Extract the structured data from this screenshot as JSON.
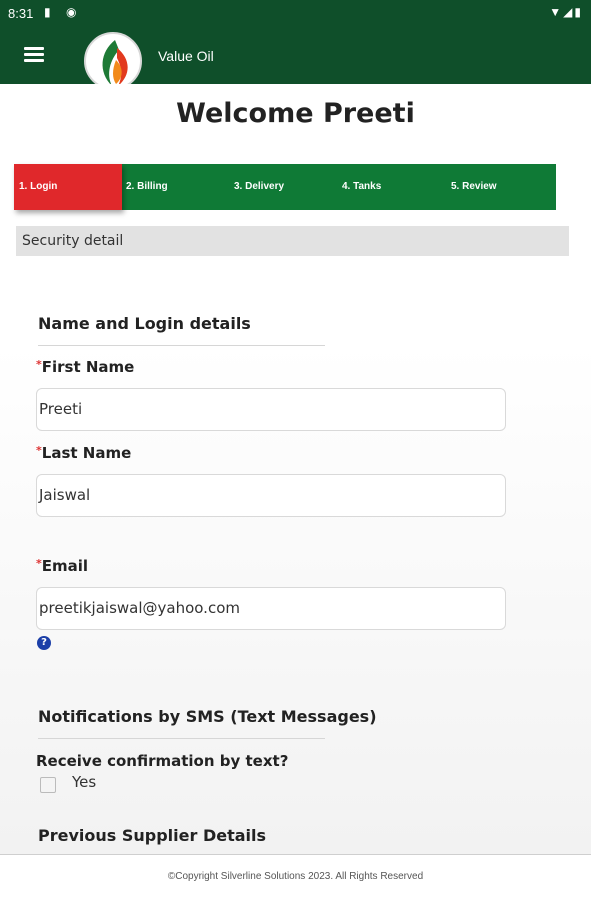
{
  "status_bar": {
    "time": "8:31"
  },
  "app_bar": {
    "title": "Value Oil"
  },
  "page": {
    "welcome": "Welcome Preeti"
  },
  "steps": [
    {
      "label": "1. Login"
    },
    {
      "label": "2. Billing"
    },
    {
      "label": "3. Delivery"
    },
    {
      "label": "4. Tanks"
    },
    {
      "label": "5. Review"
    }
  ],
  "section": {
    "title": "Security detail"
  },
  "login_details": {
    "heading": "Name and Login details",
    "required_mark": "*",
    "first_name_label": "First Name",
    "first_name_value": "Preeti",
    "last_name_label": "Last Name",
    "last_name_value": "Jaiswal",
    "email_label": "Email",
    "email_value": "preetikjaiswal@yahoo.com",
    "help_glyph": "?"
  },
  "sms": {
    "heading": "Notifications by SMS (Text Messages)",
    "question": "Receive confirmation by text?",
    "option_label": "Yes"
  },
  "previous_supplier": {
    "heading": "Previous Supplier Details"
  },
  "footer": {
    "text": "©Copyright Silverline Solutions 2023. All Rights Reserved"
  },
  "colors": {
    "header_green": "#0f4f2a",
    "steps_green": "#0f7a36",
    "active_step_red": "#e0282b",
    "help_blue": "#1c3fa8"
  }
}
